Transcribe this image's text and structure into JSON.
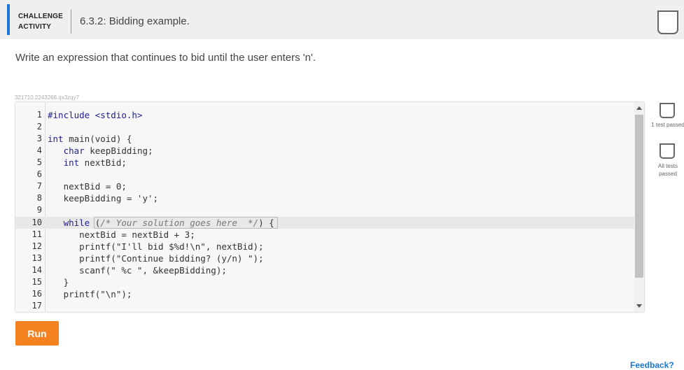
{
  "header": {
    "badge_line1": "CHALLENGE",
    "badge_line2": "ACTIVITY",
    "title": "6.3.2: Bidding example."
  },
  "instructions": "Write an expression that continues to bid until the user enters 'n'.",
  "activity_id": "321710.2243268.qx3zqy7",
  "editor": {
    "line_numbers": [
      "1",
      "2",
      "3",
      "4",
      "5",
      "6",
      "7",
      "8",
      "9",
      "10",
      "11",
      "12",
      "13",
      "14",
      "15",
      "16",
      "17"
    ],
    "lines": {
      "l1": "#include <stdio.h>",
      "l3a": "int",
      "l3b": " main(void) {",
      "l4a": "   char",
      "l4b": " keepBidding;",
      "l5a": "   int",
      "l5b": " nextBid;",
      "l7": "   nextBid = 0;",
      "l8": "   keepBidding = 'y';",
      "l10a": "   while",
      "l10b": " (",
      "l10c": "/* Your solution goes here  */",
      "l10d": ") {",
      "l11": "      nextBid = nextBid + 3;",
      "l12": "      printf(\"I'll bid $%d!\\n\", nextBid);",
      "l13": "      printf(\"Continue bidding? (y/n) \");",
      "l14": "      scanf(\" %c \", &keepBidding);",
      "l15": "   }",
      "l16": "   printf(\"\\n\");"
    }
  },
  "tests": {
    "test1_label": "1 test passed",
    "test2_label": "All tests passed"
  },
  "run_label": "Run",
  "feedback_label": "Feedback?",
  "colors": {
    "accent": "#1a76d2",
    "run_button": "#f58220",
    "keyword": "#1e1e8f"
  }
}
